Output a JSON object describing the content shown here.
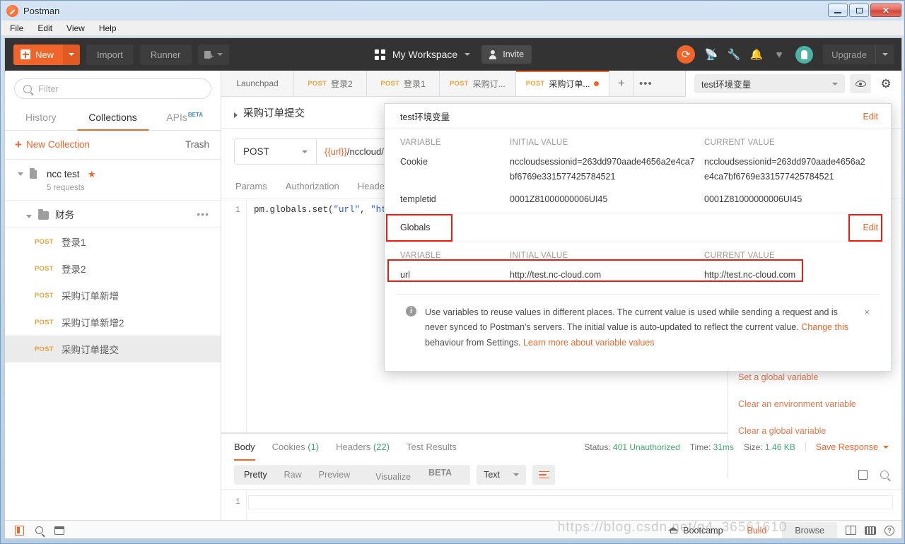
{
  "window": {
    "title": "Postman",
    "minimize_label": "Minimize",
    "maximize_label": "Maximize",
    "close_label": "Close"
  },
  "menubar": {
    "items": [
      "File",
      "Edit",
      "View",
      "Help"
    ]
  },
  "toolbar": {
    "new_label": "New",
    "import_label": "Import",
    "runner_label": "Runner",
    "workspace_label": "My Workspace",
    "invite_label": "Invite",
    "upgrade_label": "Upgrade"
  },
  "sidebar": {
    "filter_placeholder": "Filter",
    "filter_value": "",
    "tabs": [
      {
        "label": "History",
        "active": false
      },
      {
        "label": "Collections",
        "active": true
      },
      {
        "label": "APIs",
        "badge": "BETA",
        "active": false
      }
    ],
    "new_collection_label": "New Collection",
    "trash_label": "Trash",
    "collection": {
      "name": "ncc test",
      "requests_count": "5 requests",
      "folder": "财务",
      "requests": [
        {
          "method": "POST",
          "name": "登录1",
          "selected": false
        },
        {
          "method": "POST",
          "name": "登录2",
          "selected": false
        },
        {
          "method": "POST",
          "name": "采购订单新增",
          "selected": false
        },
        {
          "method": "POST",
          "name": "采购订单新增2",
          "selected": false
        },
        {
          "method": "POST",
          "name": "采购订单提交",
          "selected": true
        }
      ]
    }
  },
  "tabs": [
    {
      "label": "Launchpad",
      "method": "",
      "active": false,
      "unsaved": false
    },
    {
      "label": "登录2",
      "method": "POST",
      "active": false,
      "unsaved": false
    },
    {
      "label": "登录1",
      "method": "POST",
      "active": false,
      "unsaved": false
    },
    {
      "label": "采购订...",
      "method": "POST",
      "active": false,
      "unsaved": false
    },
    {
      "label": "采购订单...",
      "method": "POST",
      "active": true,
      "unsaved": true
    }
  ],
  "environment": {
    "selected": "test环境变量",
    "eye_label": "Environment quick look",
    "gear_label": "Manage environments"
  },
  "request": {
    "title": "采购订单提交",
    "method": "POST",
    "url_var": "{{url}}",
    "url_rest": "/nccloud/pu",
    "tabs": [
      "Params",
      "Authorization",
      "Header"
    ],
    "code_line_no": "1",
    "code_prefix": "pm.globals.set(",
    "code_arg1": "\"url\"",
    "code_comma": ", ",
    "code_arg2": "\"ht"
  },
  "snippets": [
    "Set a global variable",
    "Clear an environment variable",
    "Clear a global variable"
  ],
  "response": {
    "tabs": [
      {
        "label": "Body",
        "count": "",
        "active": true
      },
      {
        "label": "Cookies",
        "count": "(1)",
        "active": false
      },
      {
        "label": "Headers",
        "count": "(22)",
        "active": false
      },
      {
        "label": "Test Results",
        "count": "",
        "active": false
      }
    ],
    "status_label": "Status:",
    "status_value": "401 Unauthorized",
    "time_label": "Time:",
    "time_value": "31ms",
    "size_label": "Size:",
    "size_value": "1.46 KB",
    "save_response_label": "Save Response",
    "view_modes": [
      "Pretty",
      "Raw",
      "Preview",
      "Visualize"
    ],
    "visualize_badge": "BETA",
    "active_view_mode": "Pretty",
    "content_type": "Text",
    "body_line_no": "1",
    "body_text": ""
  },
  "env_popup": {
    "title": "test环境变量",
    "edit_label": "Edit",
    "columns": [
      "VARIABLE",
      "INITIAL VALUE",
      "CURRENT VALUE"
    ],
    "env_rows": [
      {
        "variable": "Cookie",
        "initial": "nccloudsessionid=263dd970aade4656a2e4ca7bf6769e331577425784521",
        "current": "nccloudsessionid=263dd970aade4656a2e4ca7bf6769e331577425784521"
      },
      {
        "variable": "templetid",
        "initial": "0001Z81000000006UI45",
        "current": "0001Z81000000006UI45"
      }
    ],
    "globals_title": "Globals",
    "globals_edit_label": "Edit",
    "globals_columns": [
      "VARIABLE",
      "INITIAL VALUE",
      "CURRENT VALUE"
    ],
    "globals_rows": [
      {
        "variable": "url",
        "initial": "http://test.nc-cloud.com",
        "current": "http://test.nc-cloud.com"
      }
    ],
    "note_part1": "Use variables to reuse values in different places. The current value is used while sending a request and is never synced to Postman's servers. The initial value is auto-updated to reflect the current value. ",
    "note_link1": "Change this",
    "note_part2": " behaviour from Settings. ",
    "note_link2": "Learn more about variable values",
    "close_label": "×"
  },
  "statusbar": {
    "bootcamp_label": "Bootcamp",
    "build_label": "Build",
    "browse_label": "Browse"
  },
  "watermark": "https://blog.csdn.net/q4_36561610",
  "colors": {
    "accent": "#f1652a",
    "highlight": "#f01b0f",
    "success": "#3caa6e",
    "method": "#e9a33a"
  }
}
